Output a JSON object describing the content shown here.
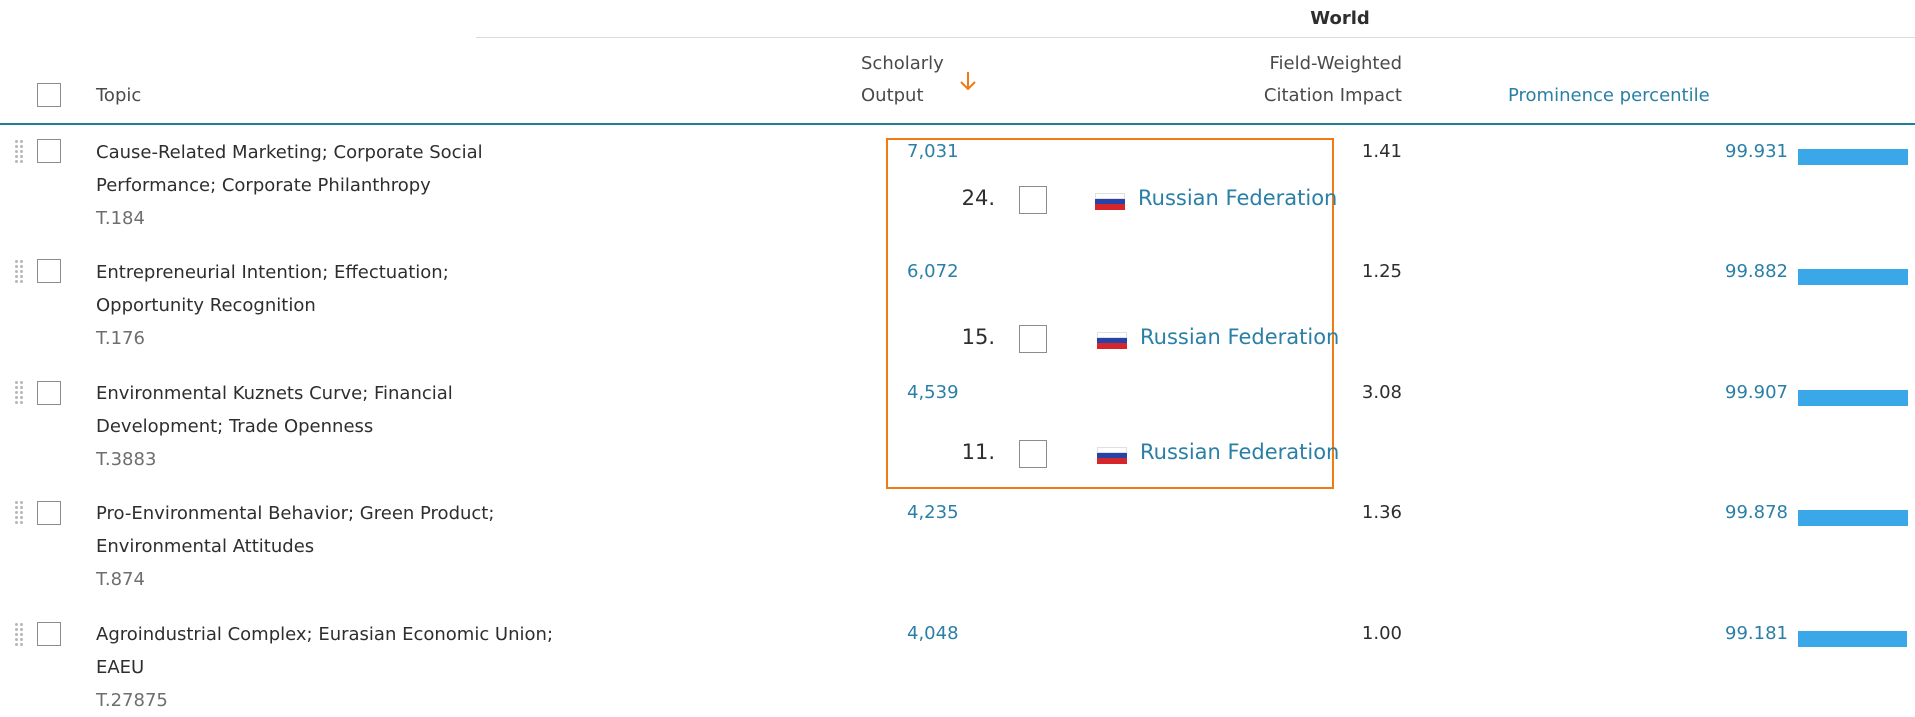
{
  "header": {
    "world_label": "World",
    "topic_label": "Topic",
    "scholarly_output_line1": "Scholarly",
    "scholarly_output_line2": "Output",
    "fwci_line1": "Field-Weighted",
    "fwci_line2": "Citation Impact",
    "prominence_label": "Prominence percentile",
    "sort_icon": "arrow-down-icon"
  },
  "rows": [
    {
      "topic_line1": "Cause-Related Marketing; Corporate Social",
      "topic_line2": "Performance; Corporate Philanthropy",
      "topic_id": "T.184",
      "scholarly_output": "7,031",
      "fwci": "1.41",
      "prominence": "99.931",
      "prominence_value": 99.931
    },
    {
      "topic_line1": "Entrepreneurial Intention; Effectuation;",
      "topic_line2": "Opportunity Recognition",
      "topic_id": "T.176",
      "scholarly_output": "6,072",
      "fwci": "1.25",
      "prominence": "99.882",
      "prominence_value": 99.882
    },
    {
      "topic_line1": "Environmental Kuznets Curve; Financial",
      "topic_line2": "Development; Trade Openness",
      "topic_id": "T.3883",
      "scholarly_output": "4,539",
      "fwci": "3.08",
      "prominence": "99.907",
      "prominence_value": 99.907
    },
    {
      "topic_line1": "Pro-Environmental Behavior; Green Product;",
      "topic_line2": "Environmental Attitudes",
      "topic_id": "T.874",
      "scholarly_output": "4,235",
      "fwci": "1.36",
      "prominence": "99.878",
      "prominence_value": 99.878
    },
    {
      "topic_line1": "Agroindustrial Complex; Eurasian Economic Union;",
      "topic_line2": "EAEU",
      "topic_id": "T.27875",
      "scholarly_output": "4,048",
      "fwci": "1.00",
      "prominence": "99.181",
      "prominence_value": 99.181
    }
  ],
  "overlay": {
    "border_color": "#f07b12",
    "items": [
      {
        "rank": "24.",
        "country": "Russian Federation",
        "flag_icon": "russia-flag-icon"
      },
      {
        "rank": "15.",
        "country": "Russian Federation",
        "flag_icon": "russia-flag-icon"
      },
      {
        "rank": "11.",
        "country": "Russian Federation",
        "flag_icon": "russia-flag-icon"
      }
    ]
  },
  "colors": {
    "link": "#2a7fa6",
    "bar": "#3aa8e8",
    "header_rule": "#1f7f96",
    "sort_arrow": "#f07b12"
  }
}
